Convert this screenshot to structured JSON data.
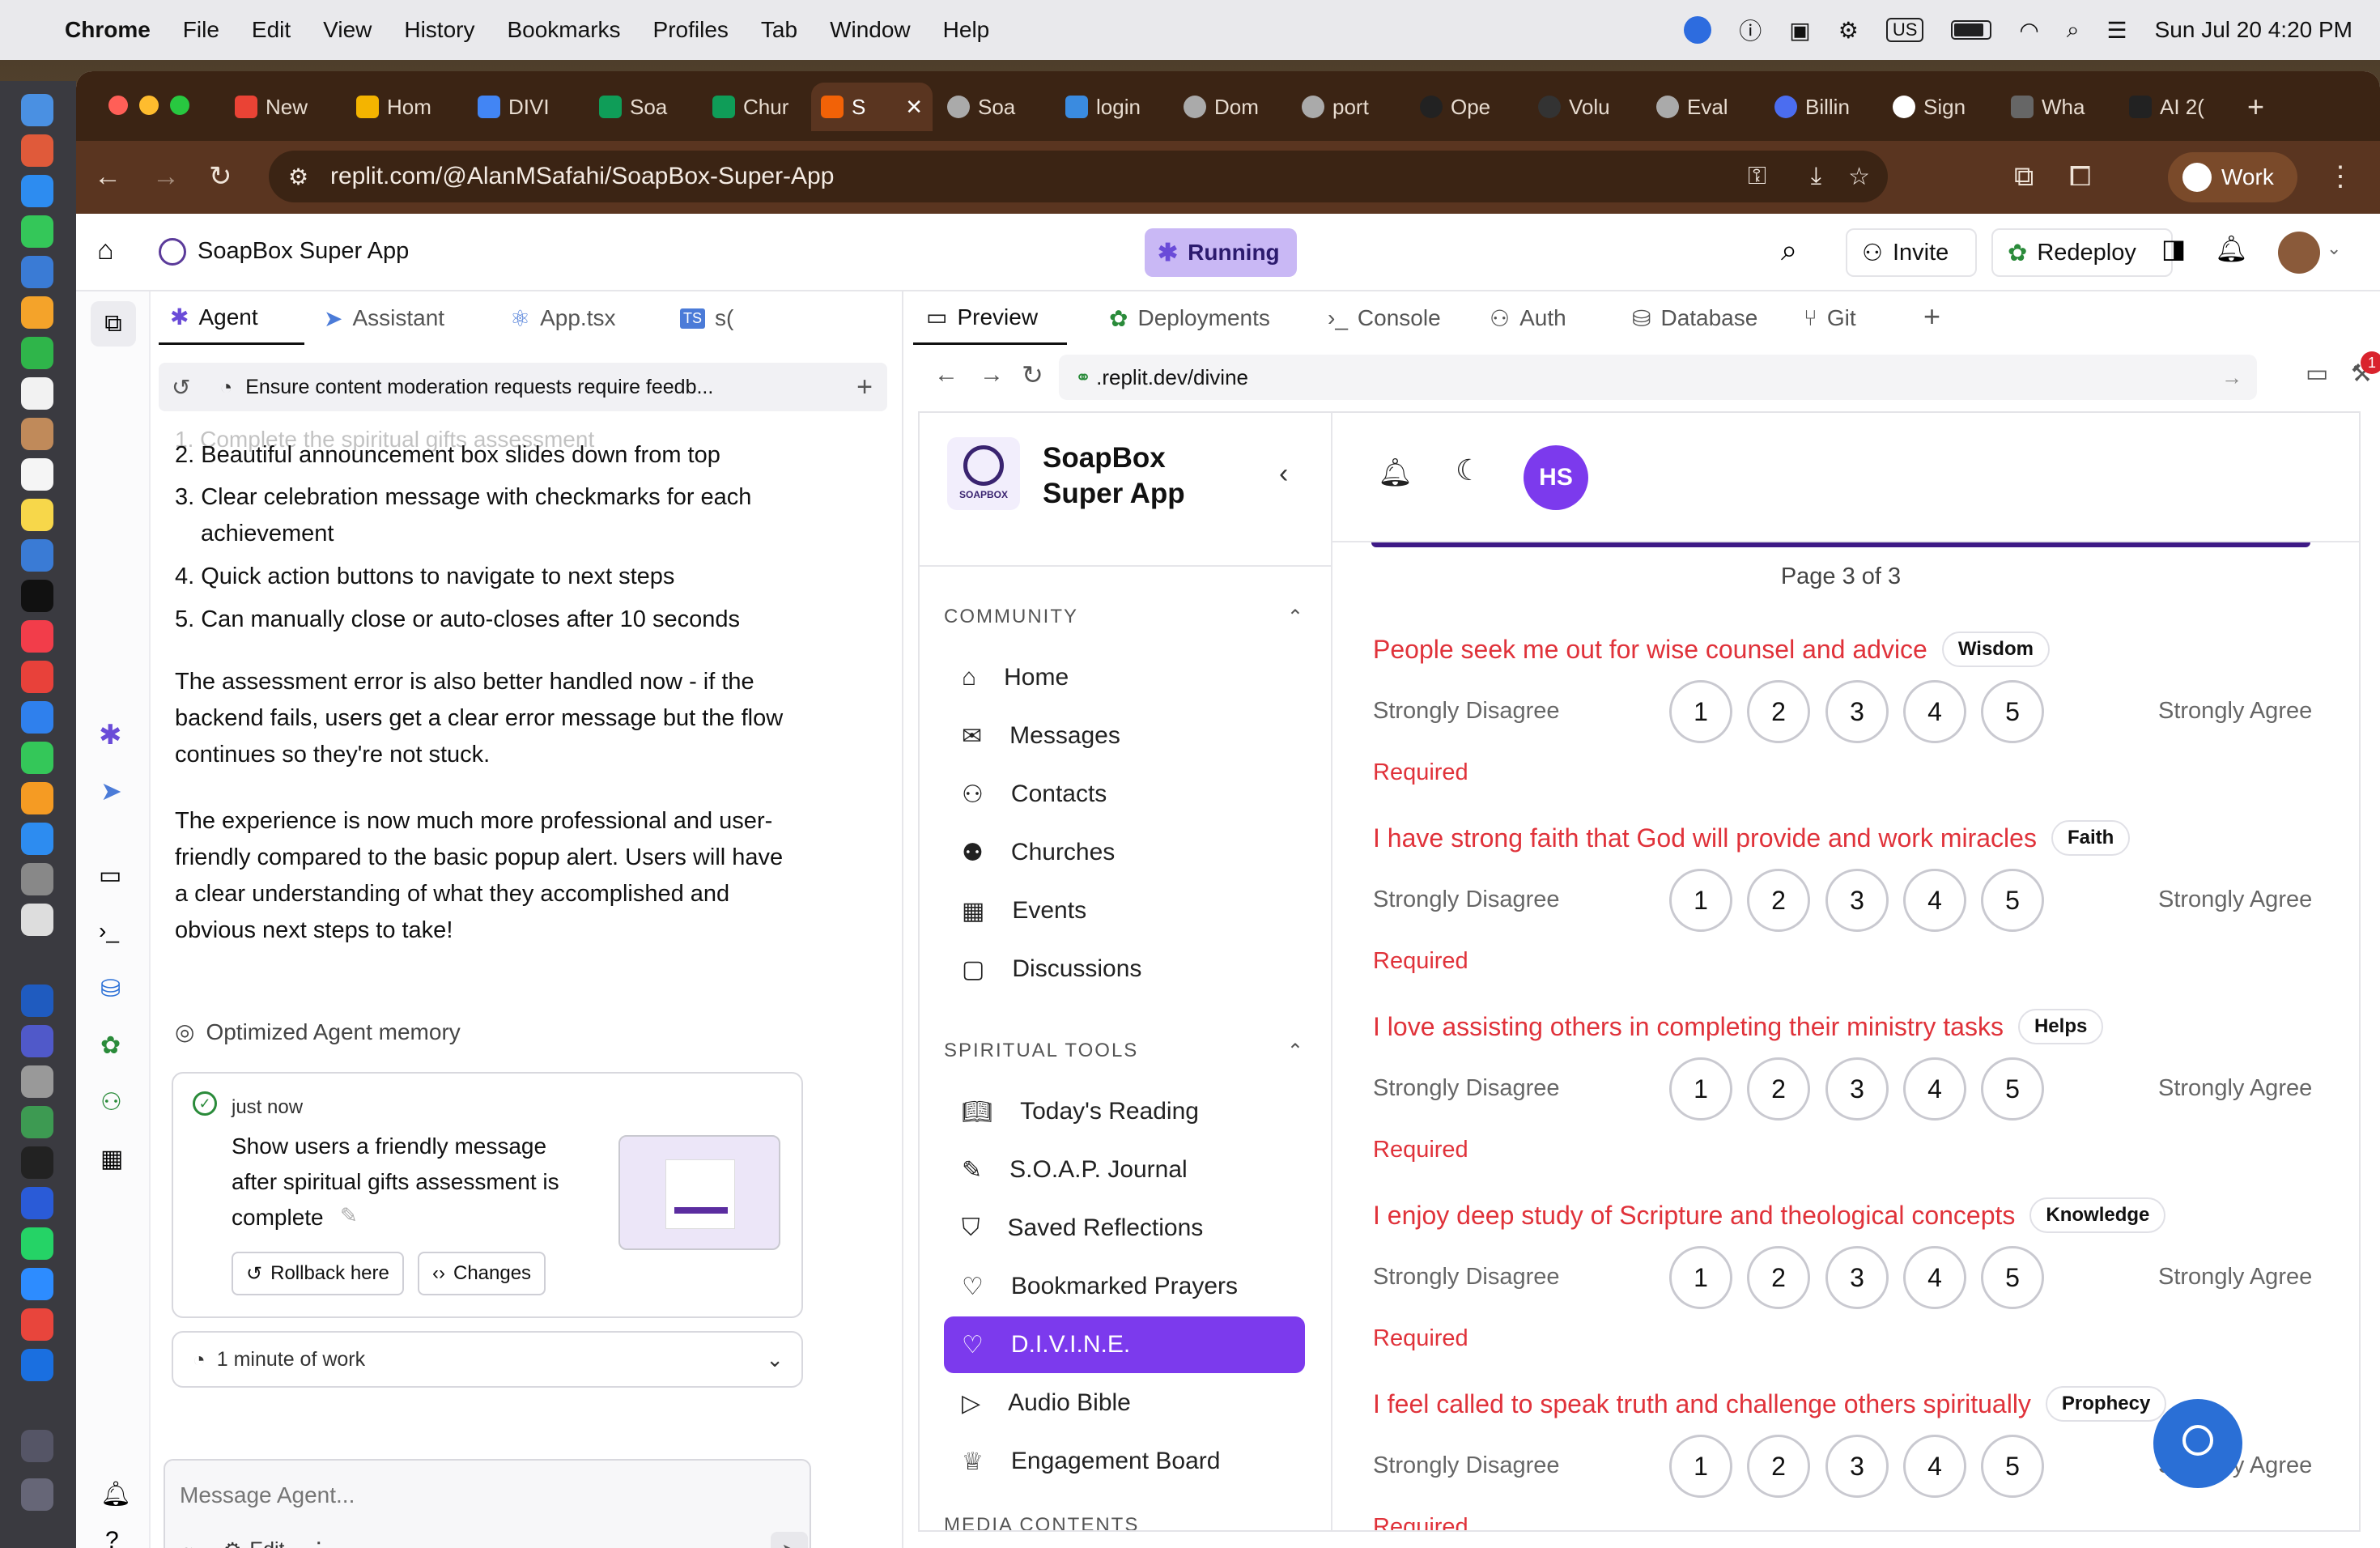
{
  "menubar": {
    "app": "Chrome",
    "items": [
      "File",
      "Edit",
      "View",
      "History",
      "Bookmarks",
      "Profiles",
      "Tab",
      "Window",
      "Help"
    ],
    "status": {
      "keyboard": "US",
      "datetime": "Sun Jul 20  4:20 PM"
    }
  },
  "browser": {
    "tabs": [
      "New",
      "Hom",
      "DIVI",
      "Soa",
      "Chur",
      "S",
      "Soa",
      "login",
      "Dom",
      "port",
      "Ope",
      "Volu",
      "Eval",
      "Billin",
      "Sign",
      "Wha",
      "AI 2("
    ],
    "active_tab_index": 5,
    "address": "replit.com/@AlanMSafahi/SoapBox-Super-App",
    "profile": "Work"
  },
  "replit": {
    "app_title": "SoapBox Super App",
    "status_pill": "Running",
    "invite_label": "Invite",
    "redeploy_label": "Redeploy",
    "left_tabs": [
      "Agent",
      "Assistant",
      "App.tsx",
      "s("
    ],
    "task_title": "Ensure content moderation requests require feedb...",
    "agent_lines": {
      "l2": "2. Beautiful announcement box slides down from top",
      "l3a": "3. Clear celebration message with checkmarks for each",
      "l3b": "achievement",
      "l4": "4. Quick action buttons to navigate to next steps",
      "l5": "5. Can manually close or auto-closes after 10 seconds",
      "p1": "The assessment error is also better handled now - if the backend fails, users get a clear error message but the flow continues so they're not stuck.",
      "p2": "The experience is now much more professional and user-friendly compared to the basic popup alert. Users will have a clear understanding of what they accomplished and obvious next steps to take!",
      "memory": "Optimized Agent memory"
    },
    "checkpoint": {
      "time": "just now",
      "text": "Show users a friendly message after spiritual gifts assessment is complete",
      "rollback": "Rollback here",
      "changes": "Changes"
    },
    "work_summary": "1 minute of work",
    "message_placeholder": "Message Agent...",
    "edit_label": "Edit",
    "right_tabs": [
      "Preview",
      "Deployments",
      "Console",
      "Auth",
      "Database",
      "Git"
    ],
    "preview_url": ".replit.dev/divine",
    "notification_count": "1"
  },
  "soapbox": {
    "brand_line1": "SoapBox",
    "brand_line2": "Super App",
    "logo_text": "SOAPBOX",
    "avatar_initials": "HS",
    "community_header": "COMMUNITY",
    "community": [
      "Home",
      "Messages",
      "Contacts",
      "Churches",
      "Events",
      "Discussions"
    ],
    "tools_header": "SPIRITUAL TOOLS",
    "tools": [
      "Today's Reading",
      "S.O.A.P. Journal",
      "Saved Reflections",
      "Bookmarked Prayers",
      "D.I.V.I.N.E.",
      "Audio Bible",
      "Engagement Board"
    ],
    "next_header": "MEDIA CONTENTS",
    "page_indicator": "Page 3 of 3",
    "scale_left": "Strongly Disagree",
    "scale_right": "Strongly Agree",
    "required": "Required",
    "questions": [
      {
        "text": "People seek me out for wise counsel and advice",
        "tag": "Wisdom"
      },
      {
        "text": "I have strong faith that God will provide and work miracles",
        "tag": "Faith"
      },
      {
        "text": "I love assisting others in completing their ministry tasks",
        "tag": "Helps"
      },
      {
        "text": "I enjoy deep study of Scripture and theological concepts",
        "tag": "Knowledge"
      },
      {
        "text": "I feel called to speak truth and challenge others spiritually",
        "tag": "Prophecy"
      }
    ],
    "scale_values": [
      "1",
      "2",
      "3",
      "4",
      "5"
    ]
  },
  "colors": {
    "accent_purple": "#7c3aed",
    "question_red": "#e0323a",
    "browser_brown": "#5a3520"
  }
}
